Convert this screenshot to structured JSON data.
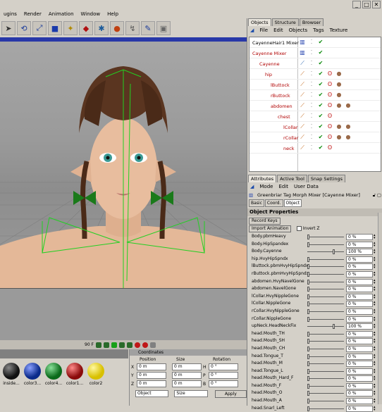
{
  "menu": [
    "ugins",
    "Render",
    "Animation",
    "Window",
    "Help"
  ],
  "window_buttons": [
    "_",
    "□",
    "✕"
  ],
  "toolbar_icons": [
    "cursor-icon",
    "rotate-icon",
    "scale-icon",
    "cube-icon",
    "spline-icon",
    "nurbs-icon",
    "light-icon",
    "deform-icon",
    "bend-icon",
    "pen-icon",
    "scene-icon"
  ],
  "objects_tabs": [
    "Objects",
    "Structure",
    "Browser"
  ],
  "objects_menu": [
    "File",
    "Edit",
    "Objects",
    "Tags",
    "Texture"
  ],
  "objects": [
    {
      "name": "CayenneHair1 Mixer",
      "indent": 0,
      "color": "black"
    },
    {
      "name": "Cayenne Mixer",
      "indent": 0,
      "color": "red"
    },
    {
      "name": "Cayenne",
      "indent": 1,
      "color": "red"
    },
    {
      "name": "hip",
      "indent": 2,
      "color": "red"
    },
    {
      "name": "lButtock",
      "indent": 3,
      "color": "red"
    },
    {
      "name": "rButtock",
      "indent": 3,
      "color": "red"
    },
    {
      "name": "abdomen",
      "indent": 3,
      "color": "red"
    },
    {
      "name": "chest",
      "indent": 4,
      "color": "red"
    },
    {
      "name": "lCollar",
      "indent": 5,
      "color": "red"
    },
    {
      "name": "rCollar",
      "indent": 5,
      "color": "red"
    },
    {
      "name": "neck",
      "indent": 5,
      "color": "red"
    }
  ],
  "attr_tabs": [
    "Attributes",
    "Active Tool",
    "Snap Settings"
  ],
  "attr_menu": [
    "Mode",
    "Edit",
    "User Data"
  ],
  "attr_header": "Greenbriar Tag Morph Mixer [Cayenne Mixer]",
  "attr_subtabs": [
    "Basic",
    "Coord.",
    "Object"
  ],
  "object_properties_title": "Object Properties",
  "record_keys": "Record Keys",
  "import_animation": "Import Animation",
  "invert_z": "Invert Z",
  "properties": [
    {
      "label": "Body.pbmHeavy",
      "value": "0 %",
      "pos": 0
    },
    {
      "label": "Body.HipSpandex",
      "value": "0 %",
      "pos": 0
    },
    {
      "label": "Body.Cayenne",
      "value": "100 %",
      "pos": 0.7
    },
    {
      "label": "hip.HvyHipSpndx",
      "value": "0 %",
      "pos": 0
    },
    {
      "label": "lButtock.pbmHvyHipSpndx",
      "value": "0 %",
      "pos": 0
    },
    {
      "label": "rButtock.pbmHvyHipSpndx",
      "value": "0 %",
      "pos": 0
    },
    {
      "label": "abdomen.HvyNavelGone",
      "value": "0 %",
      "pos": 0
    },
    {
      "label": "abdomen.NavelGone",
      "value": "0 %",
      "pos": 0
    },
    {
      "label": "lCollar.HvyNippleGone",
      "value": "0 %",
      "pos": 0
    },
    {
      "label": "lCollar.NippleGone",
      "value": "0 %",
      "pos": 0
    },
    {
      "label": "rCollar.HvyNippleGone",
      "value": "0 %",
      "pos": 0
    },
    {
      "label": "rCollar.NippleGone",
      "value": "0 %",
      "pos": 0
    },
    {
      "label": "upNeck.HeadNeckFix",
      "value": "100 %",
      "pos": 0.7
    },
    {
      "label": "head.Mouth_TH",
      "value": "0 %",
      "pos": 0
    },
    {
      "label": "head.Mouth_SH",
      "value": "0 %",
      "pos": 0
    },
    {
      "label": "head.Mouth_CH",
      "value": "0 %",
      "pos": 0
    },
    {
      "label": "head.Tongue_T",
      "value": "0 %",
      "pos": 0
    },
    {
      "label": "head.Mouth_M",
      "value": "0 %",
      "pos": 0
    },
    {
      "label": "head.Tongue_L",
      "value": "0 %",
      "pos": 0
    },
    {
      "label": "head.Mouth_Hard_F",
      "value": "0 %",
      "pos": 0
    },
    {
      "label": "head.Mouth_F",
      "value": "0 %",
      "pos": 0
    },
    {
      "label": "head.Mouth_O",
      "value": "0 %",
      "pos": 0
    },
    {
      "label": "head.Mouth_A",
      "value": "0 %",
      "pos": 0
    },
    {
      "label": "head.Snarl_Left",
      "value": "0 %",
      "pos": 0
    }
  ],
  "timeline_frame": "90 F",
  "materials": [
    {
      "label": "inside...",
      "color": "#111111"
    },
    {
      "label": "color3...",
      "color": "#0a2a8a"
    },
    {
      "label": "color4...",
      "color": "#0a6a1a"
    },
    {
      "label": "color1...",
      "color": "#8a0a0a"
    },
    {
      "label": "color2",
      "color": "#d8c000"
    }
  ],
  "coords": {
    "title": "Coordinates",
    "headers": [
      "Position",
      "Size",
      "Rotation"
    ],
    "rows": [
      {
        "axis": "X",
        "pos": "0 m",
        "size": "0 m",
        "rot_axis": "H",
        "rot": "0 °"
      },
      {
        "axis": "Y",
        "pos": "0 m",
        "size": "0 m",
        "rot_axis": "P",
        "rot": "0 °"
      },
      {
        "axis": "Z",
        "pos": "0 m",
        "size": "0 m",
        "rot_axis": "B",
        "rot": "0 °"
      }
    ],
    "mode_select": "Object",
    "size_select": "Size",
    "apply": "Apply"
  }
}
